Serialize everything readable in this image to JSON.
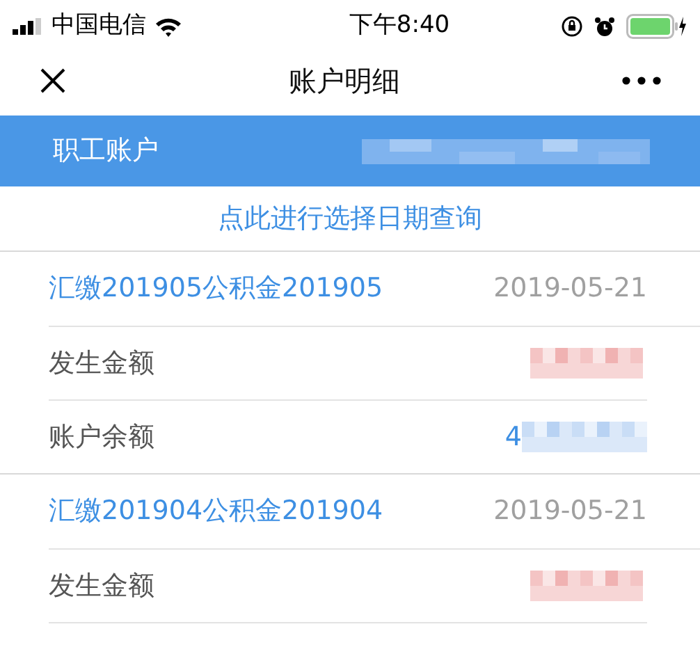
{
  "status_bar": {
    "carrier": "中国电信",
    "time": "下午8:40"
  },
  "nav": {
    "title": "账户明细"
  },
  "account_header": {
    "label": "职工账户"
  },
  "date_query_link": "点此进行选择日期查询",
  "records": [
    {
      "title": "汇缴201905公积金201905",
      "date": "2019-05-21",
      "rows": [
        {
          "label": "发生金额",
          "kind": "amount"
        },
        {
          "label": "账户余额",
          "kind": "balance",
          "value": "4"
        }
      ]
    },
    {
      "title": "汇缴201904公积金201904",
      "date": "2019-05-21",
      "rows": [
        {
          "label": "发生金额",
          "kind": "amount"
        }
      ]
    }
  ]
}
